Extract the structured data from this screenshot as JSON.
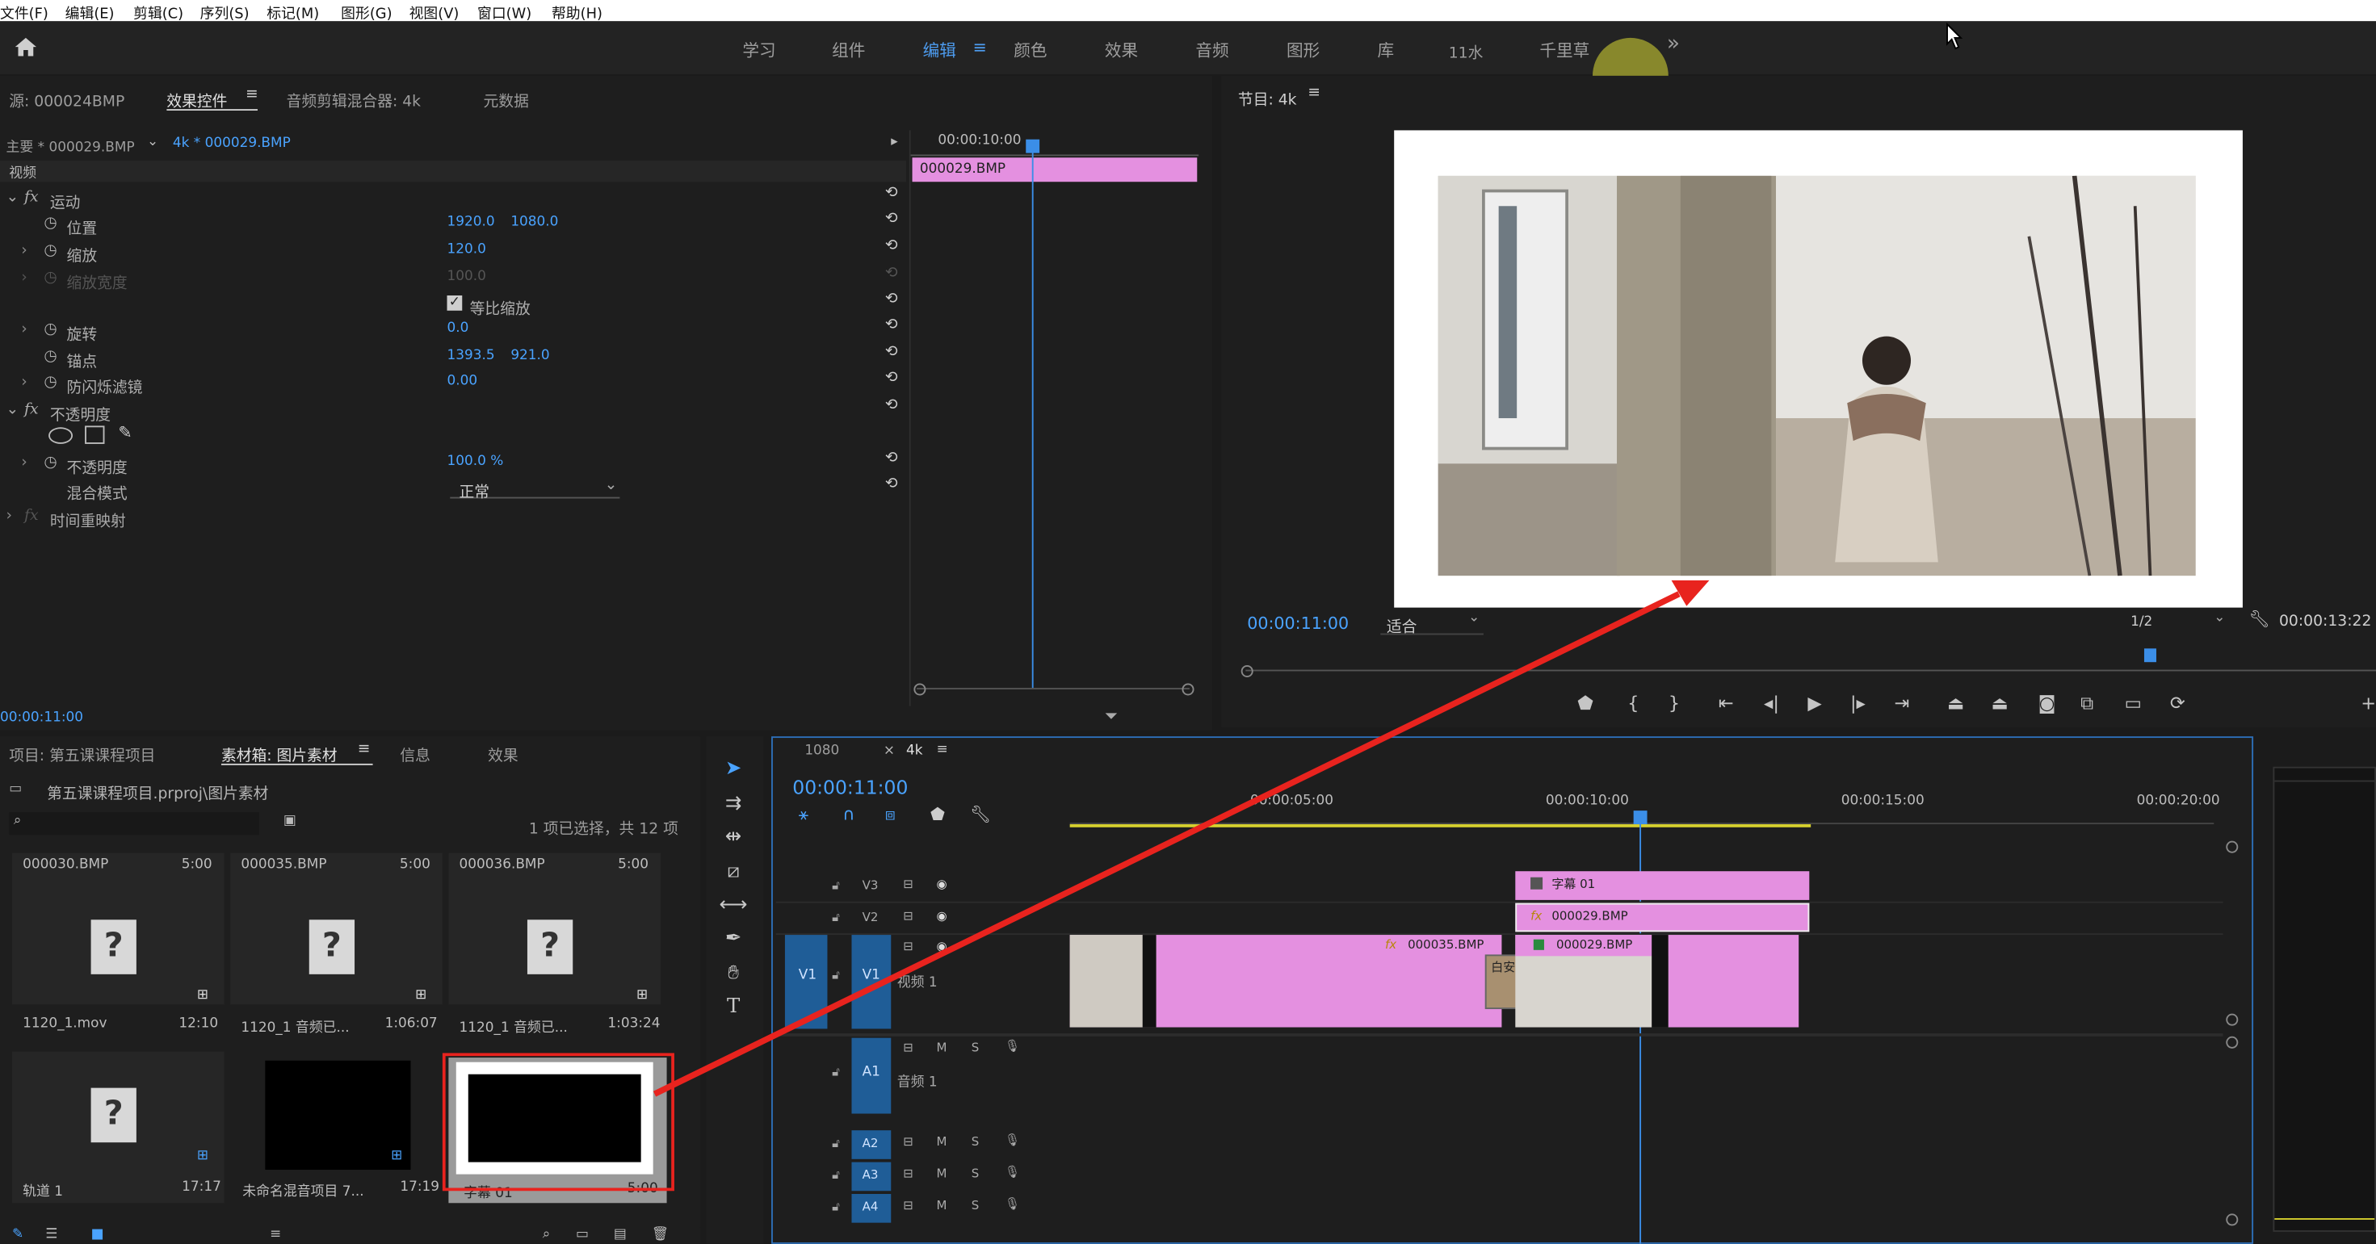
{
  "menu": [
    "文件(F)",
    "编辑(E)",
    "剪辑(C)",
    "序列(S)",
    "标记(M)",
    "图形(G)",
    "视图(V)",
    "窗口(W)",
    "帮助(H)"
  ],
  "workspaces": [
    "学习",
    "组件",
    "编辑",
    "颜色",
    "效果",
    "音频",
    "图形",
    "库",
    "11水",
    "千里草"
  ],
  "active_workspace": "编辑",
  "more_label": "»",
  "source_panel": {
    "tabs": [
      "源: 000024BMP",
      "效果控件",
      "音频剪辑混合器: 4k",
      "元数据"
    ],
    "active_tab": "效果控件",
    "master_clip": "主要 * 000029.BMP",
    "sequence_clip": "4k * 000029.BMP",
    "video_header": "视频",
    "timecode_ruler": "00:00:10:00",
    "clip_bar_name": "000029.BMP",
    "footer_timecode": "00:00:11:00",
    "rows": [
      {
        "label": "运动",
        "type": "fx"
      },
      {
        "label": "位置",
        "v1": "1920.0",
        "v2": "1080.0"
      },
      {
        "label": "缩放",
        "v1": "120.0"
      },
      {
        "label": "缩放宽度",
        "v1": "100.0",
        "disabled": true
      },
      {
        "label": "等比缩放",
        "checkbox": true
      },
      {
        "label": "旋转",
        "v1": "0.0"
      },
      {
        "label": "锚点",
        "v1": "1393.5",
        "v2": "921.0"
      },
      {
        "label": "防闪烁滤镜",
        "v1": "0.00"
      },
      {
        "label": "不透明度",
        "type": "fx"
      },
      {
        "label": "不透明度",
        "v1": "100.0 %"
      },
      {
        "label": "混合模式",
        "select": "正常"
      },
      {
        "label": "时间重映射",
        "type": "fx"
      }
    ]
  },
  "program_monitor": {
    "title": "节目: 4k",
    "timecode": "00:00:11:00",
    "fit": "适合",
    "resolution": "1/2",
    "duration": "00:00:13:22"
  },
  "project_panel": {
    "tabs": [
      "项目: 第五课课程项目",
      "素材箱: 图片素材",
      "信息",
      "效果"
    ],
    "active_tab": "素材箱: 图片素材",
    "path": "第五课课程项目.prproj\\图片素材",
    "selection_info": "1 项已选择，共 12 项",
    "items": [
      {
        "name": "000030.BMP",
        "dur": "5:00",
        "label": "1120_1.mov",
        "len": "12:10",
        "kind": "missing"
      },
      {
        "name": "000035.BMP",
        "dur": "5:00",
        "label": "1120_1 音频已...",
        "len": "1:06:07",
        "kind": "missing"
      },
      {
        "name": "000036.BMP",
        "dur": "5:00",
        "label": "1120_1 音频已...",
        "len": "1:03:24",
        "kind": "missing"
      },
      {
        "name": "",
        "dur": "",
        "label": "轨道 1",
        "len": "17:17",
        "kind": "missing"
      },
      {
        "name": "",
        "dur": "",
        "label": "未命名混音项目 7...",
        "len": "17:19",
        "kind": "black"
      },
      {
        "name": "",
        "dur": "",
        "label": "字幕 01",
        "len": "5:00",
        "kind": "title"
      }
    ]
  },
  "timeline": {
    "tabs": [
      "1080",
      "4k"
    ],
    "active_tab": "4k",
    "timecode": "00:00:11:00",
    "ruler": [
      "00:00:05:00",
      "00:00:10:00",
      "00:00:15:00",
      "00:00:20:00"
    ],
    "tracks": {
      "video": [
        "V3",
        "V2",
        "V1"
      ],
      "audio": [
        "A1",
        "A2",
        "A3",
        "A4"
      ],
      "v1_name": "视频 1",
      "a1_name": "音频 1",
      "m": "M",
      "s": "S"
    },
    "clips": {
      "v3": "字幕 01",
      "v2": "000029.BMP",
      "v1a": "000035.BMP",
      "v1b": "000029.BMP",
      "v1c": "白安"
    }
  },
  "colors": {
    "accent": "#4d9cf0",
    "clip_pink": "#e490e0",
    "arrow_red": "#e8231e",
    "playhead": "#3b8ee8",
    "cursor_circle": "#9a9a2e"
  }
}
